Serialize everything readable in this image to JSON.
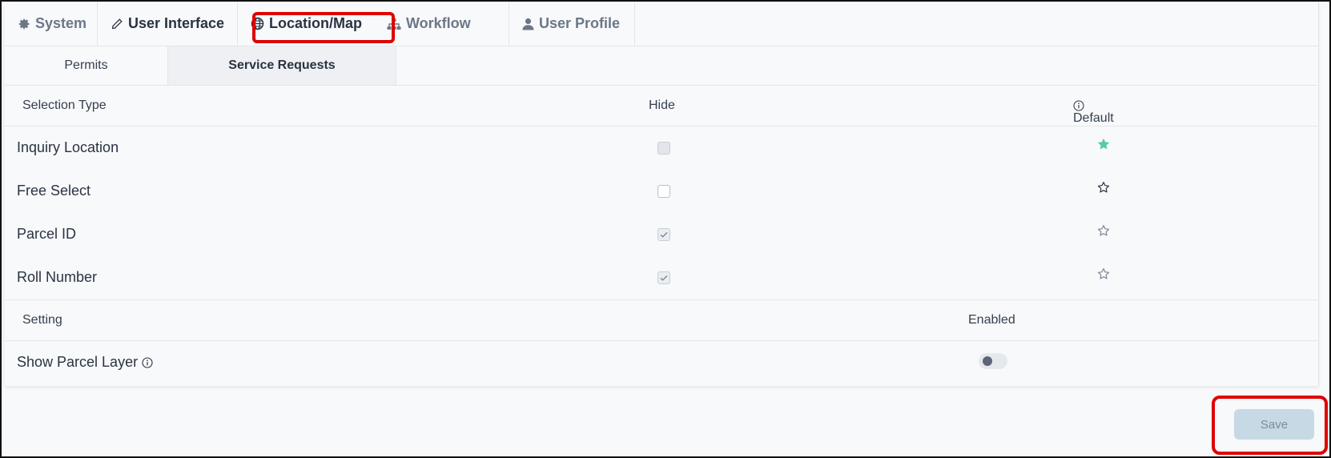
{
  "top_tabs": [
    {
      "label": "System",
      "icon": "gear-icon"
    },
    {
      "label": "User Interface",
      "icon": "pencil-icon"
    },
    {
      "label": "Location/Map",
      "icon": "globe-icon"
    },
    {
      "label": "Workflow",
      "icon": "sitemap-icon"
    },
    {
      "label": "User Profile",
      "icon": "user-icon"
    }
  ],
  "active_top_tab": "Location/Map",
  "sub_tabs": [
    {
      "label": "Permits"
    },
    {
      "label": "Service Requests"
    }
  ],
  "active_sub_tab": "Service Requests",
  "selection_table": {
    "headers": {
      "type": "Selection Type",
      "hide": "Hide",
      "default": "Default"
    },
    "rows": [
      {
        "label": "Inquiry Location",
        "hide": "unchecked-disabled",
        "default": "filled-star"
      },
      {
        "label": "Free Select",
        "hide": "unchecked",
        "default": "empty-star"
      },
      {
        "label": "Parcel ID",
        "hide": "checked-disabled",
        "default": "empty-star"
      },
      {
        "label": "Roll Number",
        "hide": "checked-disabled",
        "default": "empty-star"
      }
    ]
  },
  "settings_table": {
    "headers": {
      "setting": "Setting",
      "enabled": "Enabled"
    },
    "rows": [
      {
        "label": "Show Parcel Layer",
        "enabled": false
      }
    ]
  },
  "save_label": "Save",
  "colors": {
    "accent_star": "#5cc9a3",
    "highlight_box": "#e00000",
    "save_bg": "#c7d9e5"
  }
}
